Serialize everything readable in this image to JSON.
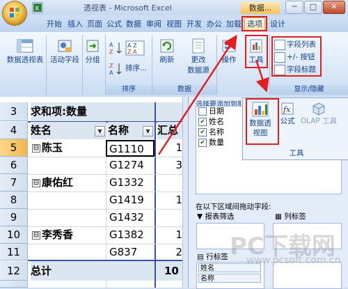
{
  "window": {
    "title": "透视表 - Microsoft Excel",
    "context_title": "数据...",
    "controls": [
      "─",
      "□",
      "✕"
    ]
  },
  "tabs": [
    "开始",
    "插入",
    "页面",
    "公式",
    "数据",
    "审阅",
    "视图",
    "开发",
    "办公",
    "加载",
    "选项",
    "设计"
  ],
  "active_tab": "选项",
  "ribbon": {
    "groups": {
      "g1": {
        "pivot_btn": "数据透视表"
      },
      "g2": {
        "active_field": "活动字段"
      },
      "g3": {
        "group": "分组"
      },
      "g4": {
        "sort": "排序...",
        "label": "排序"
      },
      "g5": {
        "refresh": "刷新",
        "change_source_1": "更改",
        "change_source_2": "数据源",
        "label": "数据"
      },
      "g6": {
        "actions": "操作"
      },
      "g7": {
        "tools": "工具"
      },
      "g8": {
        "field_list": "字段列表",
        "buttons": "+/- 按钮",
        "headers": "字段标题",
        "label": "显示/隐藏"
      }
    }
  },
  "popup": {
    "pivot_chart": "数据透视图",
    "formulas": "公式",
    "olap_tools": "OLAP 工具",
    "group_label": "工具"
  },
  "sheet": {
    "rows": [
      {
        "num": "3",
        "a": "求和项:数量",
        "b": "",
        "c": ""
      },
      {
        "num": "4",
        "a": "姓名",
        "b": "名称",
        "c": "汇总"
      },
      {
        "num": "5",
        "a": "陈玉",
        "b": "G1110",
        "c": "1"
      },
      {
        "num": "6",
        "a": "",
        "b": "G1274",
        "c": "3"
      },
      {
        "num": "7",
        "a": "康佑红",
        "b": "G1332",
        "c": ""
      },
      {
        "num": "8",
        "a": "",
        "b": "G1419",
        "c": "1"
      },
      {
        "num": "9",
        "a": "",
        "b": "G1432",
        "c": ""
      },
      {
        "num": "10",
        "a": "李秀香",
        "b": "G1382",
        "c": "1"
      },
      {
        "num": "11",
        "a": "",
        "b": "G837",
        "c": "2"
      },
      {
        "num": "12",
        "a": "总计",
        "b": "",
        "c": "10"
      }
    ],
    "expander": "⊟",
    "dropdown": "▼"
  },
  "pane": {
    "section_title": "选择要添加到报表的字段:",
    "fields": [
      {
        "label": "日期",
        "checked": false
      },
      {
        "label": "姓名",
        "checked": true
      },
      {
        "label": "名称",
        "checked": true
      },
      {
        "label": "数量",
        "checked": true
      }
    ],
    "drag_hint": "在以下区域间拖动字段:",
    "report_filter": "报表筛选",
    "column_labels": "列标签",
    "row_labels": "行标签",
    "row_items": [
      "姓名",
      "名称"
    ]
  },
  "watermark": {
    "big": "PC下载网",
    "url": "www.pcsoft.com.cn"
  },
  "colors": {
    "highlight": "#e21e1e",
    "ribbon": "#dbe8f7",
    "accent": "#15428b"
  }
}
